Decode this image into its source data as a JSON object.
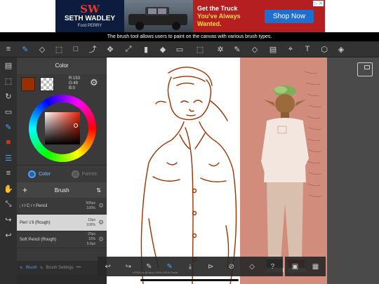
{
  "ad": {
    "logo_mark": "SW",
    "dealer_name": "SETH WADLEY",
    "dealer_sub": "Ford PERRY",
    "headline_1": "Get the Truck",
    "headline_2": "You've Always",
    "headline_3": "Wanted.",
    "cta_label": "Shop Now",
    "choice_label": "▷ ✕"
  },
  "caption": "The brush tool allows users to paint on the canvas with various brush types.",
  "toolbar": {
    "icons": [
      "menu-icon",
      "brush-tool-icon",
      "eraser-icon",
      "fill-eraser-icon",
      "rectangle-icon",
      "select-pen-icon",
      "move-icon",
      "transform-icon",
      "fill-icon",
      "bucket-icon",
      "gradient-icon",
      "lasso-select-icon",
      "magic-wand-icon",
      "select-pen-tool-icon",
      "select-eraser-icon",
      "panel-layout-icon",
      "eyedropper-icon",
      "text-icon",
      "material-icon",
      "layers-icon"
    ],
    "glyphs": [
      "≡",
      "✎",
      "◇",
      "⬚",
      "□",
      "⤴",
      "✥",
      "⤢",
      "▮",
      "◆",
      "▭",
      "⬚",
      "✲",
      "✎",
      "◇",
      "▤",
      "⌖",
      "T",
      "⬡",
      "◈"
    ]
  },
  "rail": {
    "glyphs": [
      "▤",
      "⬚",
      "↻",
      "▭",
      "✎",
      "■",
      "☰",
      "≡",
      "✋",
      "⤡",
      "↪",
      "↩"
    ]
  },
  "color": {
    "title": "Color",
    "main_color": "#992f00",
    "r": "R:153",
    "g": "G:49",
    "b": "B:0",
    "tab_color": "Color",
    "tab_palette": "Palette"
  },
  "brush": {
    "title": "Brush",
    "add_label": "+",
    "sort_label": "⇅",
    "items": [
      {
        "name": "; r l C / r Pencil",
        "size": "505px",
        "opacity": "100%"
      },
      {
        "name": "Pen' c'il (Rough)",
        "size": "19px",
        "opacity": "100%"
      },
      {
        "name": "Soft Pencil (Rough)",
        "size": "20px",
        "opacity": "10%",
        "extra": "5.0px"
      }
    ],
    "selected_index": 1
  },
  "bottom_left": {
    "brush_label": "Brush",
    "settings_label": "Brush Settings",
    "more_label": "•••"
  },
  "bottom_bar": {
    "glyphs": [
      "↩",
      "↪",
      "✎",
      "✎",
      "⤓",
      "⊳",
      "⊘",
      "◇",
      "?",
      "▣",
      "▦"
    ],
    "status": "1.0000 px (8.8px) 100% 100% Zoom"
  }
}
